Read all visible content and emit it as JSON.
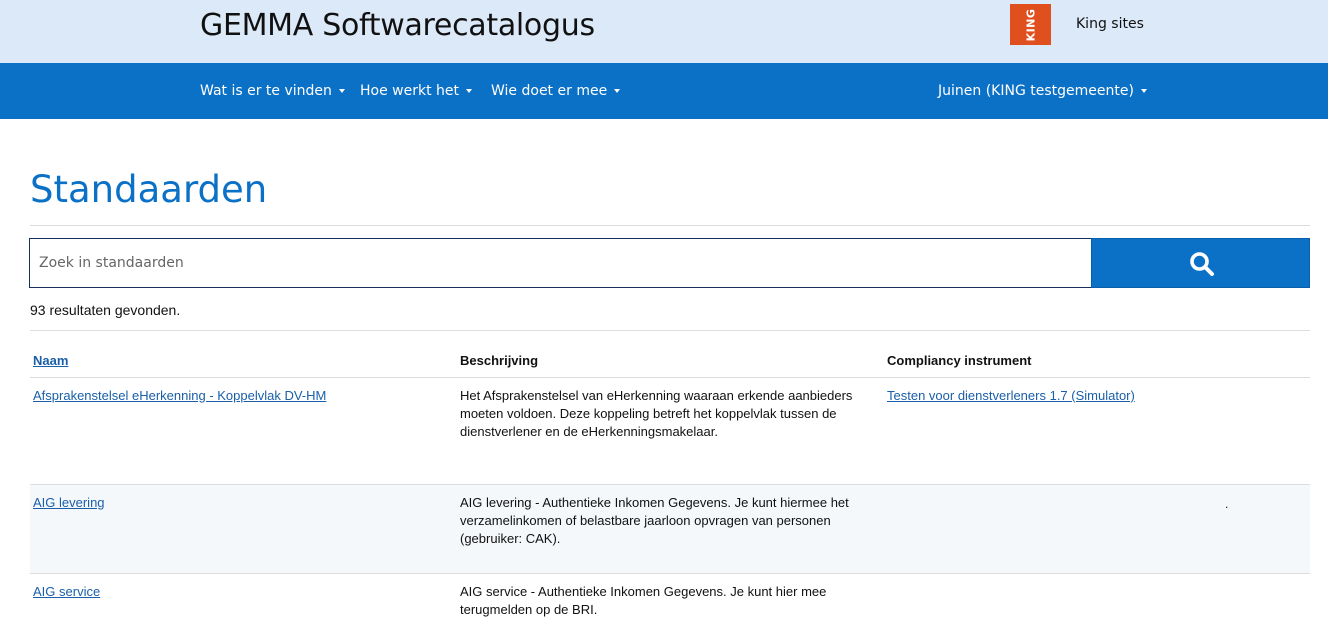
{
  "header": {
    "site_title": "GEMMA Softwarecatalogus",
    "logo_text": "KING",
    "logo_color": "#e0501e",
    "king_sites": "King sites"
  },
  "nav": {
    "items": [
      {
        "label": "Wat is er te vinden"
      },
      {
        "label": "Hoe werkt het"
      },
      {
        "label": "Wie doet er mee"
      }
    ],
    "user_menu": "Juinen (KING testgemeente)",
    "color": "#0b71c7"
  },
  "main": {
    "page_title": "Standaarden",
    "search": {
      "placeholder": "Zoek in standaarden",
      "value": "",
      "button_icon": "search-icon"
    },
    "result_count": "93 resultaten gevonden.",
    "table": {
      "headers": {
        "name": "Naam",
        "description": "Beschrijving",
        "compliancy": "Compliancy instrument"
      },
      "rows": [
        {
          "name": "Afsprakenstelsel eHerkenning - Koppelvlak DV-HM",
          "description": "Het Afsprakenstelsel van eHerkenning waaraan erkende aanbieders moeten voldoen. Deze koppeling betreft het koppelvlak tussen de dienstverlener en de eHerkenningsmakelaar.",
          "compliancy": "Testen voor dienstverleners 1.7 (Simulator)"
        },
        {
          "name": "AIG levering",
          "description": "AIG levering - Authentieke Inkomen Gegevens. Je kunt hiermee het verzamelinkomen of belastbare jaarloon opvragen van personen (gebruiker: CAK).",
          "compliancy": "",
          "extra_mark": "."
        },
        {
          "name": "AIG service",
          "description": "AIG service - Authentieke Inkomen Gegevens. Je kunt hier mee terugmelden op de BRI.",
          "compliancy": ""
        }
      ]
    }
  }
}
